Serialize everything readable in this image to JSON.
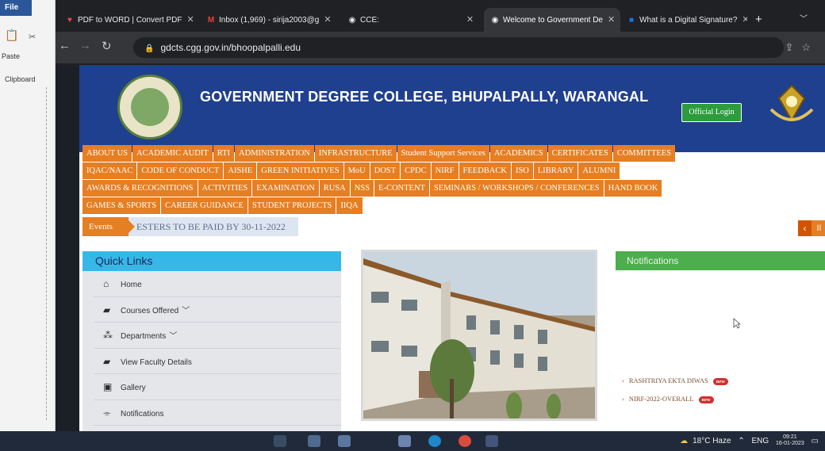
{
  "word": {
    "file_tab": "File",
    "paste_label": "Paste",
    "clipboard_label": "Clipboard"
  },
  "browser": {
    "tabs": [
      {
        "title": "PDF to WORD | Convert PDF",
        "favicon": "pdf-icon",
        "color": "#e5484d"
      },
      {
        "title": "Inbox (1,969) - sirija2003@g",
        "favicon": "gmail-icon",
        "color": "#ea4335"
      },
      {
        "title": "CCE:",
        "favicon": "globe-icon",
        "color": "#e8eaed"
      },
      {
        "title": "Welcome to Government De",
        "favicon": "globe-icon",
        "color": "#e8eaed"
      },
      {
        "title": "What is a Digital Signature?",
        "favicon": "blog-icon",
        "color": "#1a73e8"
      }
    ],
    "active_tab": 3,
    "new_tab_label": "+",
    "url": "gdcts.cgg.gov.in/bhoopalpalli.edu"
  },
  "site": {
    "colors": {
      "header": "#1f3f8f",
      "menu": "#e67e22",
      "quicklinks": "#35b8e8",
      "notifications": "#4cae4c"
    },
    "title": "GOVERNMENT DEGREE COLLEGE, BHUPALPALLY, WARANGAL",
    "login_label": "Official Login",
    "menu_rows": [
      [
        "ABOUT US",
        "ACADEMIC AUDIT",
        "RTI",
        "ADMINISTRATION",
        "INFRASTRUCTURE",
        "Student Support Services",
        "ACADEMICS",
        "CERTIFICATES",
        "COMMITTEES"
      ],
      [
        "IQAC/NAAC",
        "CODE OF CONDUCT",
        "AISHE",
        "GREEN INITIATIVES",
        "MoU",
        "DOST",
        "CPDC",
        "NIRF",
        "FEEDBACK",
        "ISO",
        "LIBRARY",
        "ALUMNI"
      ],
      [
        "AWARDS & RECOGNITIONS",
        "ACTIVITIES",
        "EXAMINATION",
        "RUSA",
        "NSS",
        "E-CONTENT",
        "SEMINARS / WORKSHOPS / CONFERENCES",
        "HAND BOOK"
      ],
      [
        "GAMES & SPORTS",
        "CAREER GUIDANCE",
        "STUDENT PROJECTS",
        "IIQA"
      ]
    ],
    "events_label": "Events",
    "events_ticker": "ESTERS TO BE PAID BY 30-11-2022",
    "quick_links": {
      "title": "Quick Links",
      "items": [
        {
          "label": "Home",
          "icon": "home-icon",
          "glyph": "⌂"
        },
        {
          "label": "Courses Offered",
          "icon": "book-icon",
          "glyph": "▰",
          "chevron": "﹀"
        },
        {
          "label": "Departments",
          "icon": "sitemap-icon",
          "glyph": "⁂",
          "chevron": "﹀"
        },
        {
          "label": "View Faculty Details",
          "icon": "book-icon",
          "glyph": "▰"
        },
        {
          "label": "Gallery",
          "icon": "image-icon",
          "glyph": "▣"
        },
        {
          "label": "Notifications",
          "icon": "tag-icon",
          "glyph": "⌯"
        }
      ]
    },
    "notifications": {
      "title": "Notifications",
      "items": [
        {
          "text": "RASHTRIYA EKTA DIWAS",
          "badge": "new"
        },
        {
          "text": "NIRF-2022-OVERALL",
          "badge": "new"
        }
      ]
    }
  },
  "taskbar": {
    "weather": "18°C Haze",
    "lang": "ENG",
    "time": "09:21",
    "date": "16-01-2023"
  }
}
